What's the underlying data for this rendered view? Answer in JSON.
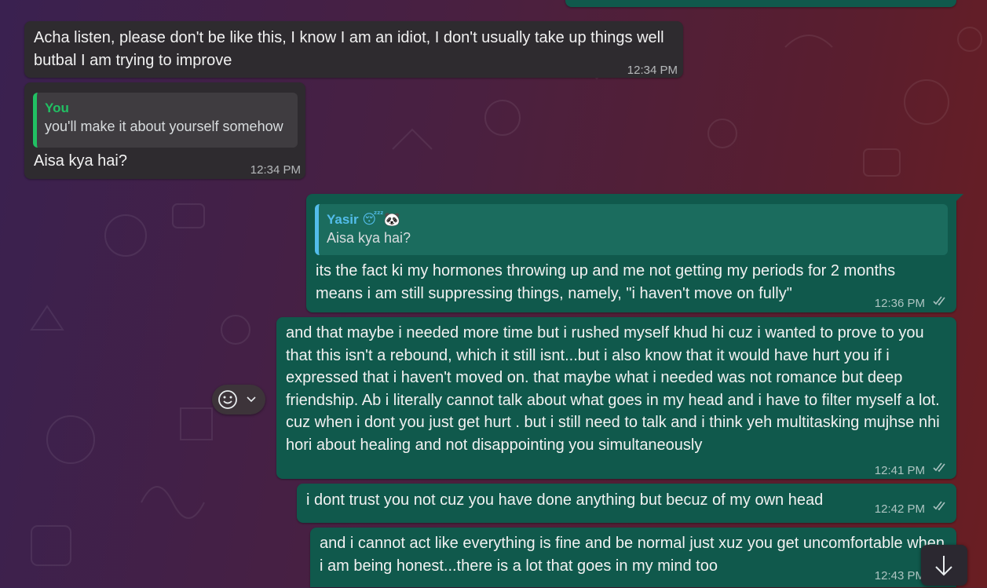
{
  "messages": [
    {
      "text": "Acha listen, please don't be like this, I know I am an idiot, I don't usually take up things well butbal I am trying to improve",
      "time": "12:34 PM"
    },
    {
      "quote_author": "You",
      "quote_text": "you'll make it about yourself somehow",
      "text": "Aisa kya hai?",
      "time": "12:34 PM"
    },
    {
      "quote_author": "Yasir 😴🐼",
      "quote_text": "Aisa kya hai?",
      "text": "its the fact ki my hormones throwing up and me not getting my periods for 2 months means i am still suppressing things, namely, \"i haven't move on fully\"",
      "time": "12:36 PM"
    },
    {
      "text": "and that maybe i needed more time but i rushed myself khud hi cuz i wanted to prove to you that this isn't a rebound, which it still isnt...but i also know that it would have hurt you if i expressed that i haven't moved on. that maybe what i needed was not romance but deep friendship. Ab i literally cannot talk about what goes in my head and i have to filter myself a lot. cuz when i dont you just get hurt . but i still need to talk and i think yeh multitasking mujhse nhi hori about healing and not disappointing you simultaneously",
      "time": "12:41 PM"
    },
    {
      "text": "i dont trust you not cuz you have done anything but becuz of my own head",
      "time": "12:42 PM"
    },
    {
      "text": "and i cannot act like everything is fine and be normal just xuz you get uncomfortable when i am being honest...there is a lot that goes in my mind too",
      "time": "12:43 PM"
    }
  ],
  "icons": {
    "read_ticks": "double-check-icon",
    "emoji": "smiley-icon",
    "chevron": "chevron-down-icon",
    "scroll": "arrow-down-icon"
  },
  "colors": {
    "incoming_bubble": "#2e2b2f",
    "outgoing_bubble": "#10594c",
    "quote_you_accent": "#21c063",
    "quote_yasir_accent": "#53bdeb"
  }
}
